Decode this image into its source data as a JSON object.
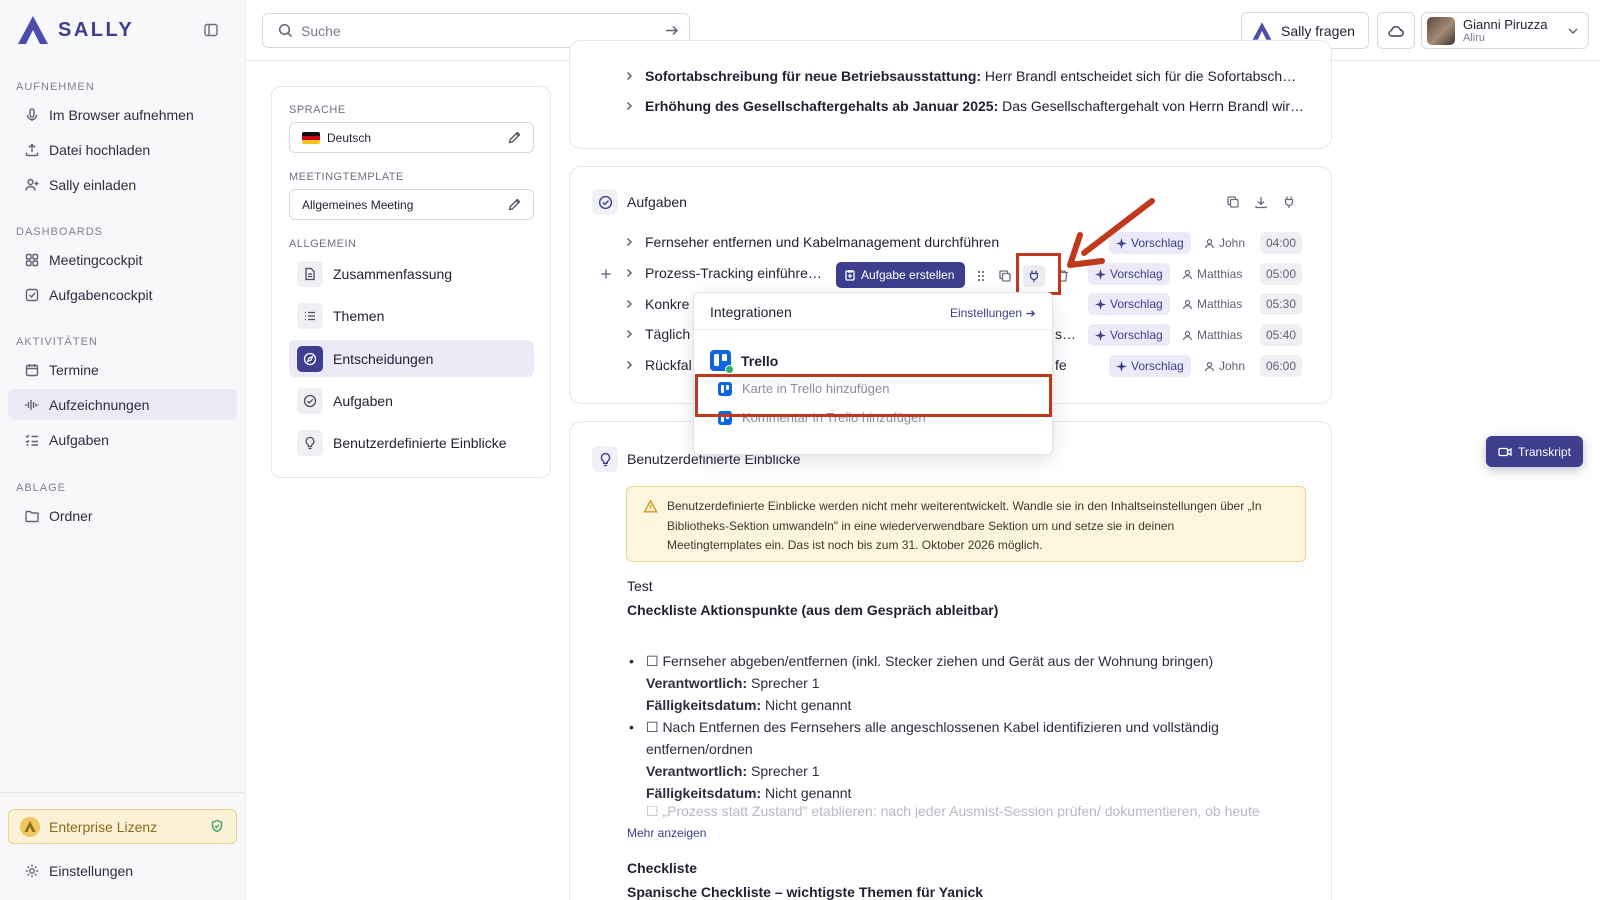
{
  "app": {
    "name": "SALLY"
  },
  "colors": {
    "accent": "#3d3e8e",
    "highlight": "#c0391c",
    "warning_bg": "#fdf6df",
    "license_bg": "#fbf1d6"
  },
  "sidebar": {
    "sections": [
      {
        "title": "AUFNEHMEN",
        "items": [
          {
            "label": "Im Browser aufnehmen",
            "icon": "mic-icon"
          },
          {
            "label": "Datei hochladen",
            "icon": "upload-icon"
          },
          {
            "label": "Sally einladen",
            "icon": "user-plus-icon"
          }
        ]
      },
      {
        "title": "DASHBOARDS",
        "items": [
          {
            "label": "Meetingcockpit",
            "icon": "grid-icon"
          },
          {
            "label": "Aufgabencockpit",
            "icon": "checkbox-icon"
          }
        ]
      },
      {
        "title": "AKTIVITÄTEN",
        "items": [
          {
            "label": "Termine",
            "icon": "calendar-icon"
          },
          {
            "label": "Aufzeichnungen",
            "icon": "waveform-icon",
            "active": true
          },
          {
            "label": "Aufgaben",
            "icon": "list-check-icon"
          }
        ]
      },
      {
        "title": "ABLAGE",
        "items": [
          {
            "label": "Ordner",
            "icon": "folder-icon"
          }
        ]
      }
    ],
    "license": "Enterprise Lizenz",
    "settings": "Einstellungen"
  },
  "topbar": {
    "search_placeholder": "Suche",
    "ask_label": "Sally fragen",
    "user_name": "Gianni Piruzza",
    "user_org": "Aliru"
  },
  "settings_panel": {
    "language_label": "SPRACHE",
    "language_value": "Deutsch",
    "template_label": "MEETINGTEMPLATE",
    "template_value": "Allgemeines Meeting",
    "general_label": "ALLGEMEIN",
    "items": [
      {
        "label": "Zusammenfassung",
        "icon": "document-icon"
      },
      {
        "label": "Themen",
        "icon": "list-icon"
      },
      {
        "label": "Entscheidungen",
        "icon": "compass-icon",
        "active": true
      },
      {
        "label": "Aufgaben",
        "icon": "check-circle-icon"
      },
      {
        "label": "Benutzerdefinierte Einblicke",
        "icon": "lightbulb-icon"
      }
    ]
  },
  "decisions": {
    "rows": [
      {
        "bold": "Sofortabschreibung für neue Betriebsausstattung:",
        "text": " Herr Brandl entscheidet sich für die Sofortabsch…"
      },
      {
        "bold": "Erhöhung des Gesellschaftergehalts ab Januar 2025:",
        "text": " Das Gesellschaftergehalt von Herrn Brandl wir…"
      }
    ]
  },
  "tasks": {
    "title": "Aufgaben",
    "create_button": "Aufgabe erstellen",
    "rows": [
      {
        "text": "Fernseher entfernen und Kabelmanagement durchführen",
        "tag": "Vorschlag",
        "owner": "John",
        "time": "04:00"
      },
      {
        "text": "Prozess-Tracking einführe…",
        "tag": "Vorschlag",
        "owner": "Matthias",
        "time": "05:00"
      },
      {
        "text": "Konkre",
        "tag": "Vorschlag",
        "owner": "Matthias",
        "time": "05:30"
      },
      {
        "text": "Täglich",
        "tail": "s…",
        "tag": "Vorschlag",
        "owner": "Matthias",
        "time": "05:40"
      },
      {
        "text": "Rückfal",
        "tail": "fe",
        "tag": "Vorschlag",
        "owner": "John",
        "time": "06:00"
      }
    ]
  },
  "integrations": {
    "title": "Integrationen",
    "settings_link": "Einstellungen",
    "provider": "Trello",
    "actions": [
      "Karte in Trello hinzufügen",
      "Kommentar in Trello hinzufügen"
    ]
  },
  "insights": {
    "title": "Benutzerdefinierte Einblicke",
    "warning_lines": [
      "Benutzerdefinierte Einblicke werden nicht mehr weiterentwickelt. Wandle sie in den Inhaltseinstellungen über „In",
      "Bibliotheks-Sektion umwandeln\" in eine wiederverwendbare Sektion um und setze sie in deinen",
      "Meetingtemplates ein. Das ist noch bis zum 31. Oktober 2026 möglich."
    ],
    "test_label": "Test",
    "checklist_title": "Checkliste Aktionspunkte (aus dem Gespräch ableitbar)",
    "responsible_label": "Verantwortlich:",
    "due_label": "Fälligkeitsdatum:",
    "items": [
      {
        "lines": [
          "☐ Fernseher abgeben/entfernen (inkl. Stecker ziehen und Gerät aus der Wohnung bringen)"
        ],
        "responsible": " Sprecher 1",
        "due": " Nicht genannt"
      },
      {
        "lines": [
          "☐ Nach Entfernen des Fernsehers alle angeschlossenen Kabel identifizieren und vollständig",
          "entfernen/ordnen"
        ],
        "responsible": " Sprecher 1",
        "due": " Nicht genannt"
      }
    ],
    "faded_item": "☐ „Prozess statt Zustand\" etablieren: nach jeder Ausmist-Session prüfen/ dokumentieren, ob heute",
    "more_label": "Mehr anzeigen",
    "section2_title": "Checkliste",
    "section2_subtitle": "Spanische Checkliste – wichtigste Themen für Yanick"
  },
  "transcript_button": "Transkript"
}
